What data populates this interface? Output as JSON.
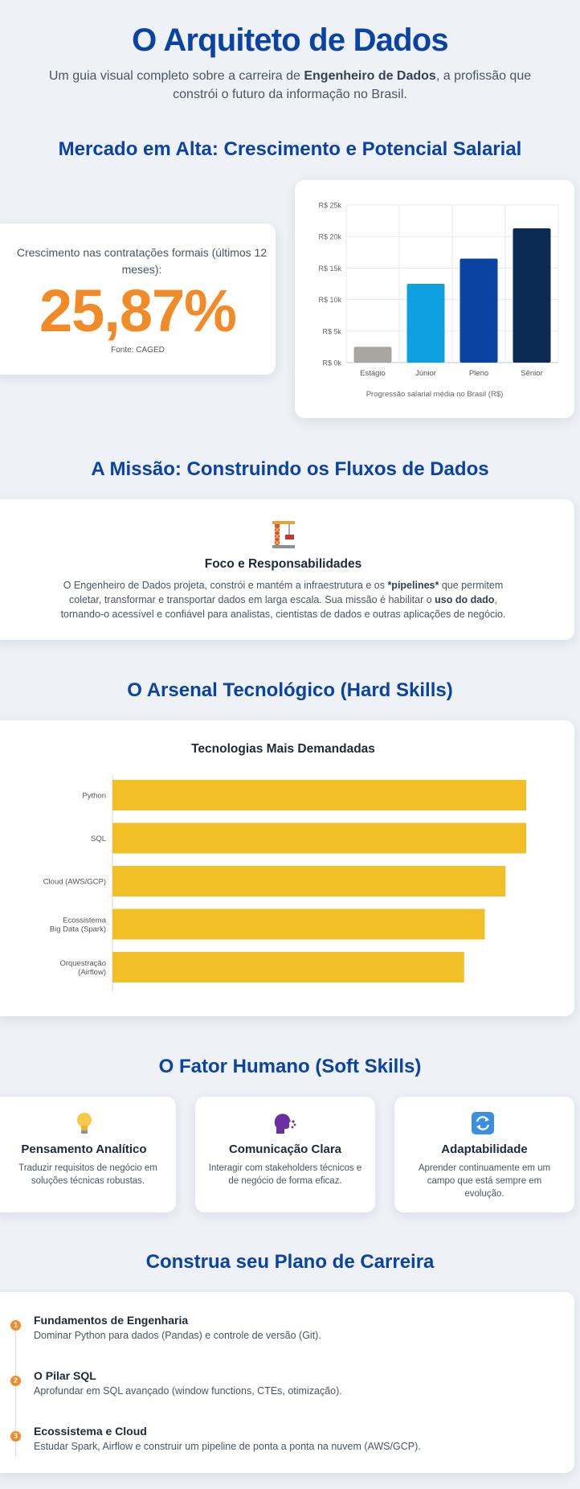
{
  "header": {
    "title": "O Arquiteto de Dados",
    "subtitle_pre": "Um guia visual completo sobre a carreira de ",
    "subtitle_bold": "Engenheiro de Dados",
    "subtitle_post": ", a profissão que constrói o futuro da informação no Brasil."
  },
  "market": {
    "section_title": "Mercado em Alta: Crescimento e Potencial Salarial",
    "growth_label": "Crescimento nas contratações formais (últimos 12 meses):",
    "growth_value": "25,87%",
    "source": "Fonte: CAGED",
    "chart_caption": "Progressão salarial média no Brasil (R$)"
  },
  "mission": {
    "section_title": "A Missão: Construindo os Fluxos de Dados",
    "card_title": "Foco e Responsabilidades",
    "text_1": "O Engenheiro de Dados projeta, constrói e mantém a infraestrutura e os ",
    "text_bold_1": "*pipelines*",
    "text_2": " que permitem coletar, transformar e transportar dados em larga escala. Sua missão é habilitar o ",
    "text_bold_2": "uso do dado",
    "text_3": ", tornando-o acessível e confiável para analistas, cientistas de dados e outras aplicações de negócio.",
    "icon": "crane-icon"
  },
  "hard_skills": {
    "section_title": "O Arsenal Tecnológico (Hard Skills)",
    "chart_title": "Tecnologias Mais Demandadas"
  },
  "soft_skills": {
    "section_title": "O Fator Humano (Soft Skills)",
    "items": [
      {
        "title": "Pensamento Analítico",
        "desc": "Traduzir requisitos de negócio em soluções técnicas robustas.",
        "icon": "lightbulb-icon"
      },
      {
        "title": "Comunicação Clara",
        "desc": "Interagir com stakeholders técnicos e de negócio de forma eficaz.",
        "icon": "speaking-head-icon"
      },
      {
        "title": "Adaptabilidade",
        "desc": "Aprender continuamente em um campo que está sempre em evolução.",
        "icon": "refresh-icon"
      }
    ]
  },
  "career": {
    "section_title": "Construa seu Plano de Carreira",
    "steps": [
      {
        "num": "1",
        "title": "Fundamentos de Engenharia",
        "desc": "Dominar Python para dados (Pandas) e controle de versão (Git)."
      },
      {
        "num": "2",
        "title": "O Pilar SQL",
        "desc": "Aprofundar em SQL avançado (window functions, CTEs, otimização)."
      },
      {
        "num": "3",
        "title": "Ecossistema e Cloud",
        "desc": "Estudar Spark, Airflow e construir um pipeline de ponta a ponta na nuvem (AWS/GCP)."
      }
    ]
  },
  "chart_data": [
    {
      "type": "bar",
      "categories": [
        "Estágio",
        "Júnior",
        "Pleno",
        "Sênior"
      ],
      "values": [
        2500,
        12500,
        16500,
        21300
      ],
      "colors": [
        "#a8a4a0",
        "#0ea0e0",
        "#0b43a3",
        "#0b2a54"
      ],
      "ylim": [
        0,
        25000
      ],
      "yticks": [
        "R$ 0k",
        "R$ 5k",
        "R$ 10k",
        "R$ 15k",
        "R$ 20k",
        "R$ 25k"
      ],
      "grid": true,
      "xlabel": "Progressão salarial média no Brasil (R$)"
    },
    {
      "type": "bar",
      "orientation": "horizontal",
      "title": "Tecnologias Mais Demandadas",
      "categories": [
        "Python",
        "SQL",
        "Cloud (AWS/GCP)",
        "Ecossistema Big Data (Spark)",
        "Orquestração (Airflow)"
      ],
      "category_lines": [
        [
          "Python"
        ],
        [
          "SQL"
        ],
        [
          "Cloud (AWS/GCP)"
        ],
        [
          "Ecossistema",
          "Big Data (Spark)"
        ],
        [
          "Orquestração",
          "(Airflow)"
        ]
      ],
      "values": [
        100,
        100,
        95,
        90,
        85
      ],
      "color": "#f3bf27"
    }
  ]
}
